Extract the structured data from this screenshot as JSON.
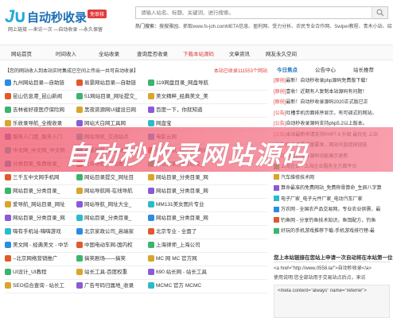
{
  "header": {
    "logo_mark": "J∪",
    "logo_text": "自动秒收录",
    "logo_badge": "免审核",
    "slogan": "网上链接 —来访一次 —自动收录 —永久保留",
    "search_placeholder": "请输入站名、标题、关键词、进行搜索。",
    "hot_label": "热门搜索：",
    "hot_items": "搜搜雅园、抓取www.fs-joh.comMETA信息、盈利网、受力分析、农民专业合作网、Swiper教程、青木小站、绍"
  },
  "nav": [
    "网站首页",
    "时间收入",
    "全站收录",
    "查询是否收录",
    "下载本站源码",
    "文章资讯",
    "网友永久空间"
  ],
  "nav_active_index": 4,
  "notice": {
    "left": "【您的网站收入到本站实时集成已空间上传出一共可自动收录】",
    "right": "本站已收录111553个网站"
  },
  "grid": [
    [
      "九州网站目录—自助链",
      "易景网站目录—自助链",
      "119网盘目录_网盘导航"
    ],
    [
      "昆山信息港_昆山新闻",
      "51网站目录_网址提交_",
      "美文精粹_经典美文_美"
    ],
    [
      "吉林省好夜医疗保险网",
      "黑夜资源网UI建设日网",
      "百度一下，你就知道"
    ],
    [
      "乐收录导航_全搜收录",
      "网站大白网工具网",
      "网盘宝"
    ],
    [
      "服务人门面_服务人门",
      "网站导航_交流站点",
      "电影云网"
    ],
    [
      "中文网_中文网_中文网",
      "多猫导航_关键词资料网",
      "网站导航_网址站_网站"
    ],
    [
      "分类目录_免费收录_",
      "大众导航_网站推广_",
      "网站目录_网址收录_"
    ],
    [
      "三千五中文网手机网",
      "网站目录提交_网址目",
      "网站目录_分类目录_网"
    ],
    [
      "网站目录_分类目录_",
      "网站导航网-在线导航",
      "网站目录_分类目录_网"
    ],
    [
      "爱导航_网站目录_网址",
      "网站导航_网址大全_",
      "MM131美女图片专业"
    ],
    [
      "网站目录_分类目录_网",
      "网站目录_分类目录_",
      "网站目录_分类目录_网"
    ],
    [
      "嗨有手机站-嗨嗨游戏",
      "北京家政公司_高端家",
      "北京专业 - 全面了"
    ],
    [
      "美文网 - 经典美文 - 中华",
      "中国电动车网-国内权",
      "上海律师_上海公司"
    ],
    [
      "--北京网络营销推广",
      "搞笑剧场——搞笑",
      "MC 网 MC 官方网"
    ],
    [
      "UI设计_UI教程",
      "站长工具-百度权重",
      "690 站长网 - 站长工具"
    ],
    [
      "SEO综合查询 - 站长工",
      "广告号码归属地_收录",
      "MCMC 官方 MCMC"
    ]
  ],
  "sidebar": {
    "tabs": [
      "今日焦点",
      "公告中心",
      "站长推荐"
    ],
    "active_tab": 0,
    "items": [
      {
        "tag": "[原创]",
        "text": "最新！自动秒收录php源码免费版下载！"
      },
      {
        "tag": "[原创]",
        "text": "壹收！近期有人复制本站源码有问题！"
      },
      {
        "tag": "[原创]",
        "text": "最新！自动秒收录源码2020正式版已正"
      },
      {
        "tag": "[公告]",
        "text": "吐槽手机页面排序显示，有可调式的网站。"
      },
      {
        "tag": "[公告]",
        "text": "自动秒收录源码支持php5.2以上版本。"
      },
      {
        "tag": "[公告]",
        "text": "本站最新申请支持PHP7.4 升级 最优化 上站"
      },
      {
        "tag": "[公告]",
        "text": "免收录需求量要发，网站内直接按钮链"
      },
      {
        "tag": "[公告]",
        "text": "自动秒收录源码功能展示更新"
      },
      {
        "tag": "",
        "text": "上海企业 - 上海企业服务全方面平台"
      },
      {
        "tag": "",
        "text": "汽车维修技术网"
      },
      {
        "tag": "",
        "text": "算命最准的免费网站_免费称骨算命_生辰八字算"
      },
      {
        "tag": "",
        "text": "电子厂家_电子元件厂家_电动汽车厂家"
      },
      {
        "tag": "",
        "text": "万农网 - 全国农产品交易网，专业农业供需，最"
      },
      {
        "tag": "",
        "text": "钓鱼网 - 分享钓鱼技术知识，鱼饵配方，钓鱼"
      },
      {
        "tag": "",
        "text": "好玩的手机游戏推荐下载-手机游戏排行榜-最"
      }
    ]
  },
  "banner_text": "自动秒收录网站源码",
  "footer_box": {
    "title": "您上本站链接在您站上申请一次自动将在本站第一位",
    "lines": [
      "<a href=\"http://www.0558.la/\">自动秒收录</a>",
      "使用说明:您全部站用于交易站点后点，来访",
      "<meta content=\"always\" name=\"referrer\">"
    ]
  },
  "colors": {
    "accent": "#e23a3a",
    "brand": "#1a6fb6",
    "banner": "#f05a6e"
  }
}
